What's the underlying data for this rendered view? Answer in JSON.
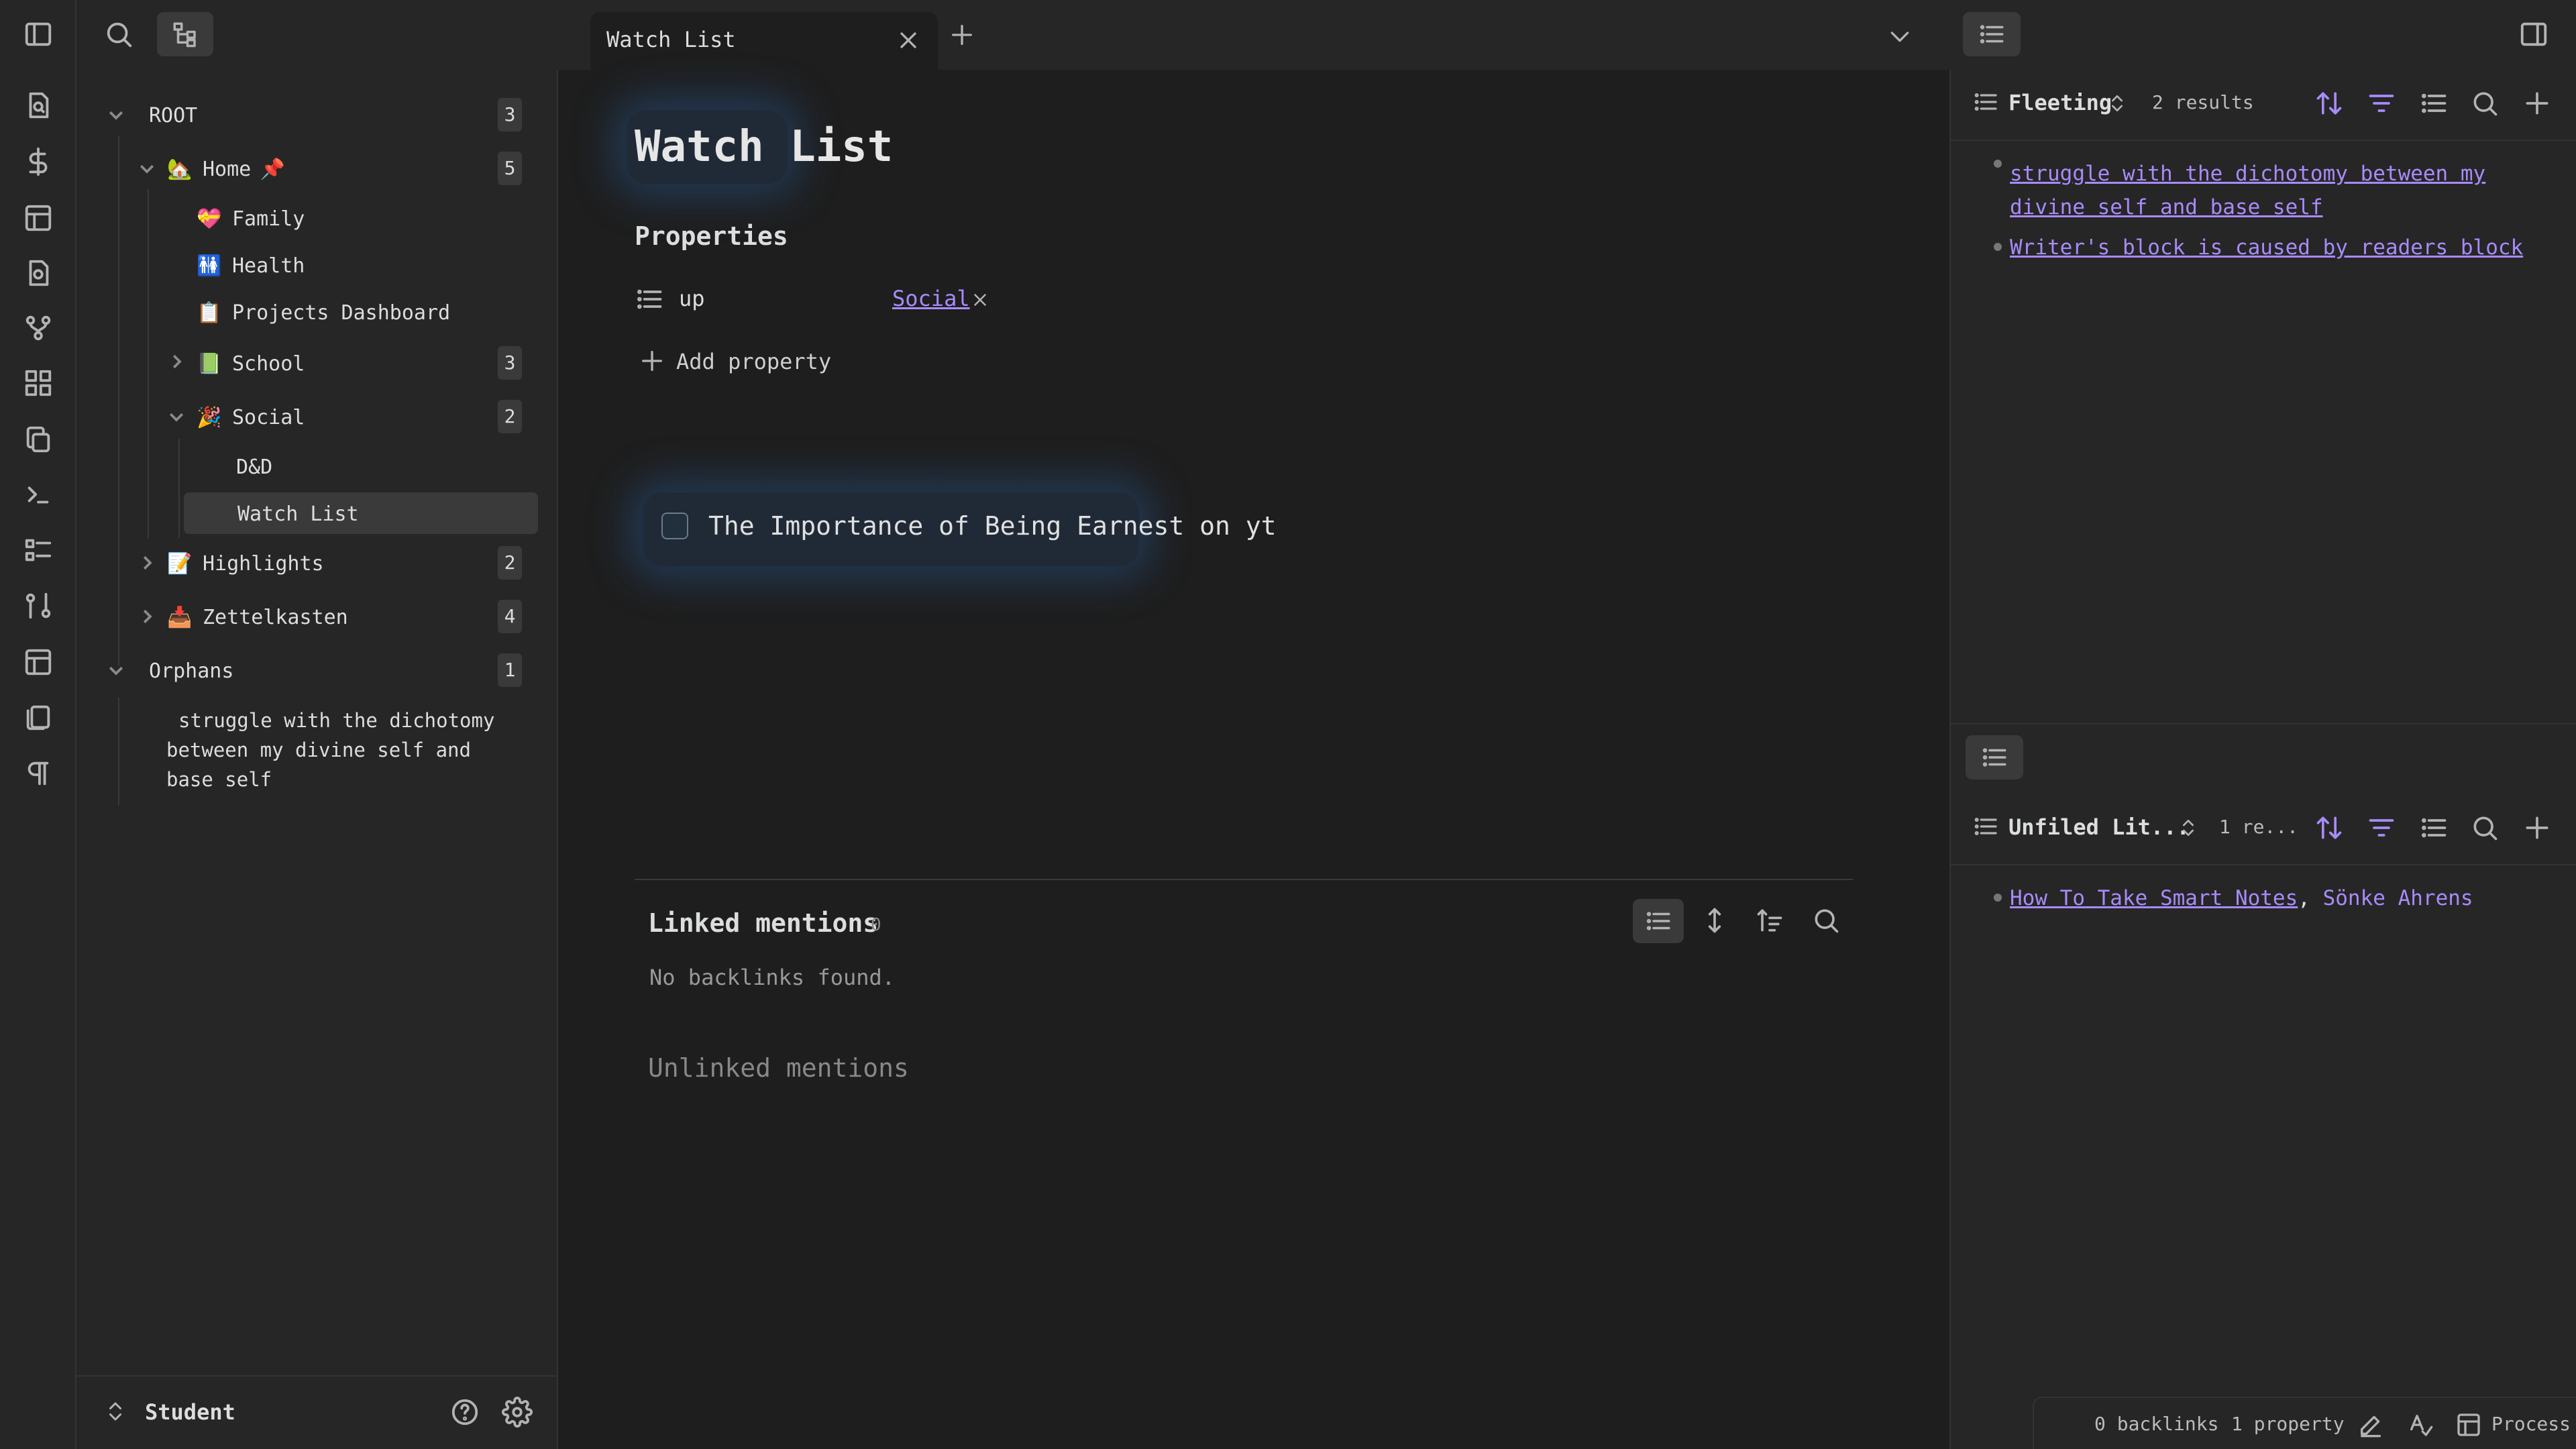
{
  "tab": {
    "title": "Watch List"
  },
  "tree": {
    "root": {
      "label": "ROOT",
      "count": "3"
    },
    "home": {
      "emoji": "🏡",
      "label": "Home",
      "pin": "📌",
      "count": "5"
    },
    "family": {
      "emoji": "💝",
      "label": "Family"
    },
    "health": {
      "emoji": "🚻",
      "label": "Health"
    },
    "projects": {
      "emoji": "📋",
      "label": "Projects Dashboard"
    },
    "school": {
      "emoji": "📗",
      "label": "School",
      "count": "3"
    },
    "social": {
      "emoji": "🎉",
      "label": "Social",
      "count": "2"
    },
    "dnd": {
      "label": "D&D"
    },
    "watchlist": {
      "label": "Watch List"
    },
    "highlights": {
      "emoji": "📝",
      "label": "Highlights",
      "count": "2"
    },
    "zettelkasten": {
      "emoji": "📥",
      "label": "Zettelkasten",
      "count": "4"
    },
    "orphans": {
      "label": "Orphans",
      "count": "1"
    },
    "orphan_note": "struggle with the dichotomy between my divine self and base self"
  },
  "footer": {
    "vault": "Student"
  },
  "note": {
    "title": "Watch List",
    "properties_heading": "Properties",
    "prop_key": "up",
    "prop_value": "Social",
    "add_property": "Add property",
    "task_text": "The Importance of Being Earnest on yt",
    "linked_mentions": "Linked mentions",
    "linked_count": "0",
    "no_backlinks": "No backlinks found.",
    "unlinked_mentions": "Unlinked mentions"
  },
  "right": {
    "top": {
      "title": "Fleeting",
      "results": "2 results",
      "items": [
        "struggle with the dichotomy between my divine self and base self",
        "Writer's block is caused by readers block"
      ]
    },
    "bottom": {
      "title": "Unfiled Lit...",
      "results": "1 re...",
      "item_link": "How To Take Smart Notes",
      "item_sep": ",",
      "item_author": "Sönke Ahrens"
    }
  },
  "status": {
    "backlinks": "0 backlinks",
    "properties": "1 property",
    "mode": "Process"
  },
  "colors": {
    "accent": "#a88bfa",
    "bg": "#1e1e1e",
    "panel": "#262626"
  }
}
